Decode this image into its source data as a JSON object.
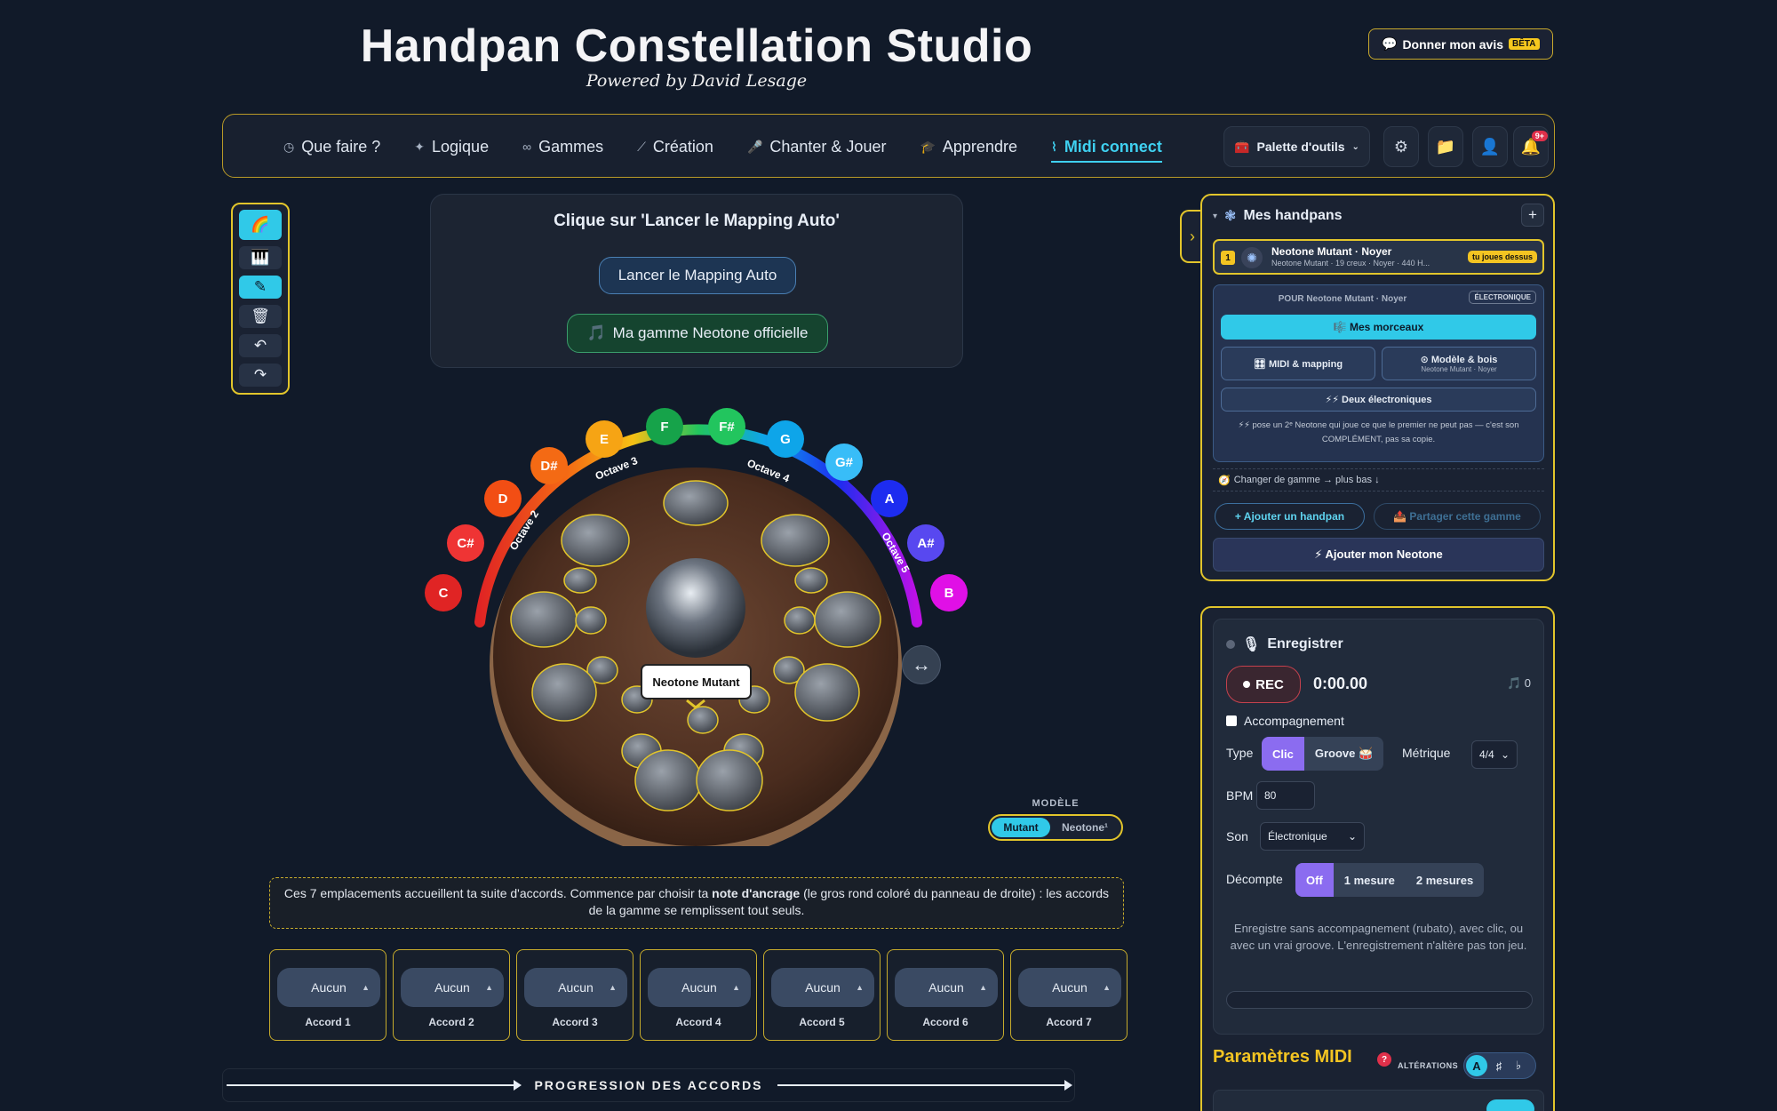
{
  "header": {
    "title": "Handpan Constellation Studio",
    "subtitle": "Powered by David Lesage",
    "feedback_label": "Donner mon avis",
    "beta_badge": "BÊTA"
  },
  "nav": {
    "items": [
      {
        "label": "Que faire ?",
        "icon": "compass-icon",
        "glyph": "◷"
      },
      {
        "label": "Logique",
        "icon": "sparkle-icon",
        "glyph": "✦"
      },
      {
        "label": "Gammes",
        "icon": "loop-icon",
        "glyph": "∞"
      },
      {
        "label": "Création",
        "icon": "wand-icon",
        "glyph": "⟋"
      },
      {
        "label": "Chanter & Jouer",
        "icon": "microphone-icon",
        "glyph": "🎤"
      },
      {
        "label": "Apprendre",
        "icon": "graduation-cap-icon",
        "glyph": "🎓"
      },
      {
        "label": "Midi connect",
        "icon": "pulse-icon",
        "glyph": "⌇"
      }
    ],
    "active": "Midi connect",
    "palette_label": "Palette d'outils",
    "notification_count": "9+"
  },
  "toolbox": {
    "tools": [
      "rainbow-icon",
      "piano-icon",
      "pencil-icon",
      "trash-icon",
      "undo-icon",
      "redo-icon"
    ]
  },
  "mapping": {
    "title": "Clique sur 'Lancer le Mapping Auto'",
    "auto_button": "Lancer le Mapping Auto",
    "gamme_button": "Ma gamme Neotone officielle"
  },
  "note_wheel": {
    "notes": [
      {
        "name": "C",
        "color": "#e02424"
      },
      {
        "name": "C#",
        "color": "#ef3434"
      },
      {
        "name": "D",
        "color": "#f24e14"
      },
      {
        "name": "D#",
        "color": "#f46a14"
      },
      {
        "name": "E",
        "color": "#f6a414"
      },
      {
        "name": "F",
        "color": "#16a34a"
      },
      {
        "name": "F#",
        "color": "#22c55e"
      },
      {
        "name": "G",
        "color": "#0ea5e9"
      },
      {
        "name": "G#",
        "color": "#38bdf8"
      },
      {
        "name": "A",
        "color": "#1d2cf0"
      },
      {
        "name": "A#",
        "color": "#5848f0"
      },
      {
        "name": "B",
        "color": "#e010e6"
      }
    ],
    "octaves": [
      "Octave 2",
      "Octave 3",
      "Octave 4",
      "Octave 5"
    ]
  },
  "handpan": {
    "label": "Neotone Mutant"
  },
  "model": {
    "label": "MODÈLE",
    "options": [
      "Mutant",
      "Neotone¹"
    ],
    "selected": "Mutant"
  },
  "info": {
    "before": "Ces 7 emplacements accueillent ta suite d'accords. Commence par choisir ta ",
    "bold": "note d'ancrage",
    "after": " (le gros rond coloré du panneau de droite) : les accords de la gamme se remplissent tout seuls."
  },
  "chords": [
    {
      "value": "Aucun",
      "name": "Accord 1"
    },
    {
      "value": "Aucun",
      "name": "Accord 2"
    },
    {
      "value": "Aucun",
      "name": "Accord 3"
    },
    {
      "value": "Aucun",
      "name": "Accord 4"
    },
    {
      "value": "Aucun",
      "name": "Accord 5"
    },
    {
      "value": "Aucun",
      "name": "Accord 6"
    },
    {
      "value": "Aucun",
      "name": "Accord 7"
    }
  ],
  "progression_label": "PROGRESSION DES ACCORDS",
  "handpans_panel": {
    "title": "Mes handpans",
    "item": {
      "number": "1",
      "name": "Neotone Mutant · Noyer",
      "meta": "Neotone Mutant · 19 creux · Noyer · 440 H...",
      "tag": "tu joues dessus"
    },
    "pour_label": "POUR Neotone Mutant · Noyer",
    "elec_tag": "ÉLECTRONIQUE",
    "morceaux": "🎼 Mes morceaux",
    "midi_mapping": "🎛 MIDI & mapping",
    "modele_bois": "⊙ Modèle & bois",
    "modele_bois_sub": "Neotone Mutant · Noyer",
    "deux_elec": "⚡⚡ Deux électroniques",
    "note": "⚡⚡ pose un 2ᵉ Neotone qui joue ce que le premier ne peut pas — c'est son COMPLÉMENT, pas sa copie.",
    "change_gamme": "Changer de gamme → plus bas ↓",
    "add_handpan": "+ Ajouter un handpan",
    "share_gamme": "📤 Partager cette gamme",
    "add_neotone": "⚡ Ajouter mon Neotone"
  },
  "record": {
    "title": "Enregistrer",
    "rec": "REC",
    "timer": "0:00.00",
    "notes_count": "0",
    "accompagnement": "Accompagnement",
    "type_label": "Type",
    "type_options": [
      "Clic",
      "Groove 🥁"
    ],
    "type_selected": "Clic",
    "metrique_label": "Métrique",
    "metrique_value": "4/4",
    "bpm_label": "BPM",
    "bpm_value": "80",
    "son_label": "Son",
    "son_value": "Électronique",
    "decompte_label": "Décompte",
    "decompte_options": [
      "Off",
      "1 mesure",
      "2 mesures"
    ],
    "decompte_selected": "Off",
    "note": "Enregistre sans accompagnement (rubato), avec clic, ou avec un vrai groove. L'enregistrement n'altère pas ton jeu.",
    "progress": 0
  },
  "midi": {
    "title": "Paramètres MIDI",
    "alterations_label": "ALTÉRATIONS",
    "alterations_options": [
      "A",
      "♯",
      "♭"
    ],
    "alterations_selected": "A",
    "sub_toggle": true
  }
}
